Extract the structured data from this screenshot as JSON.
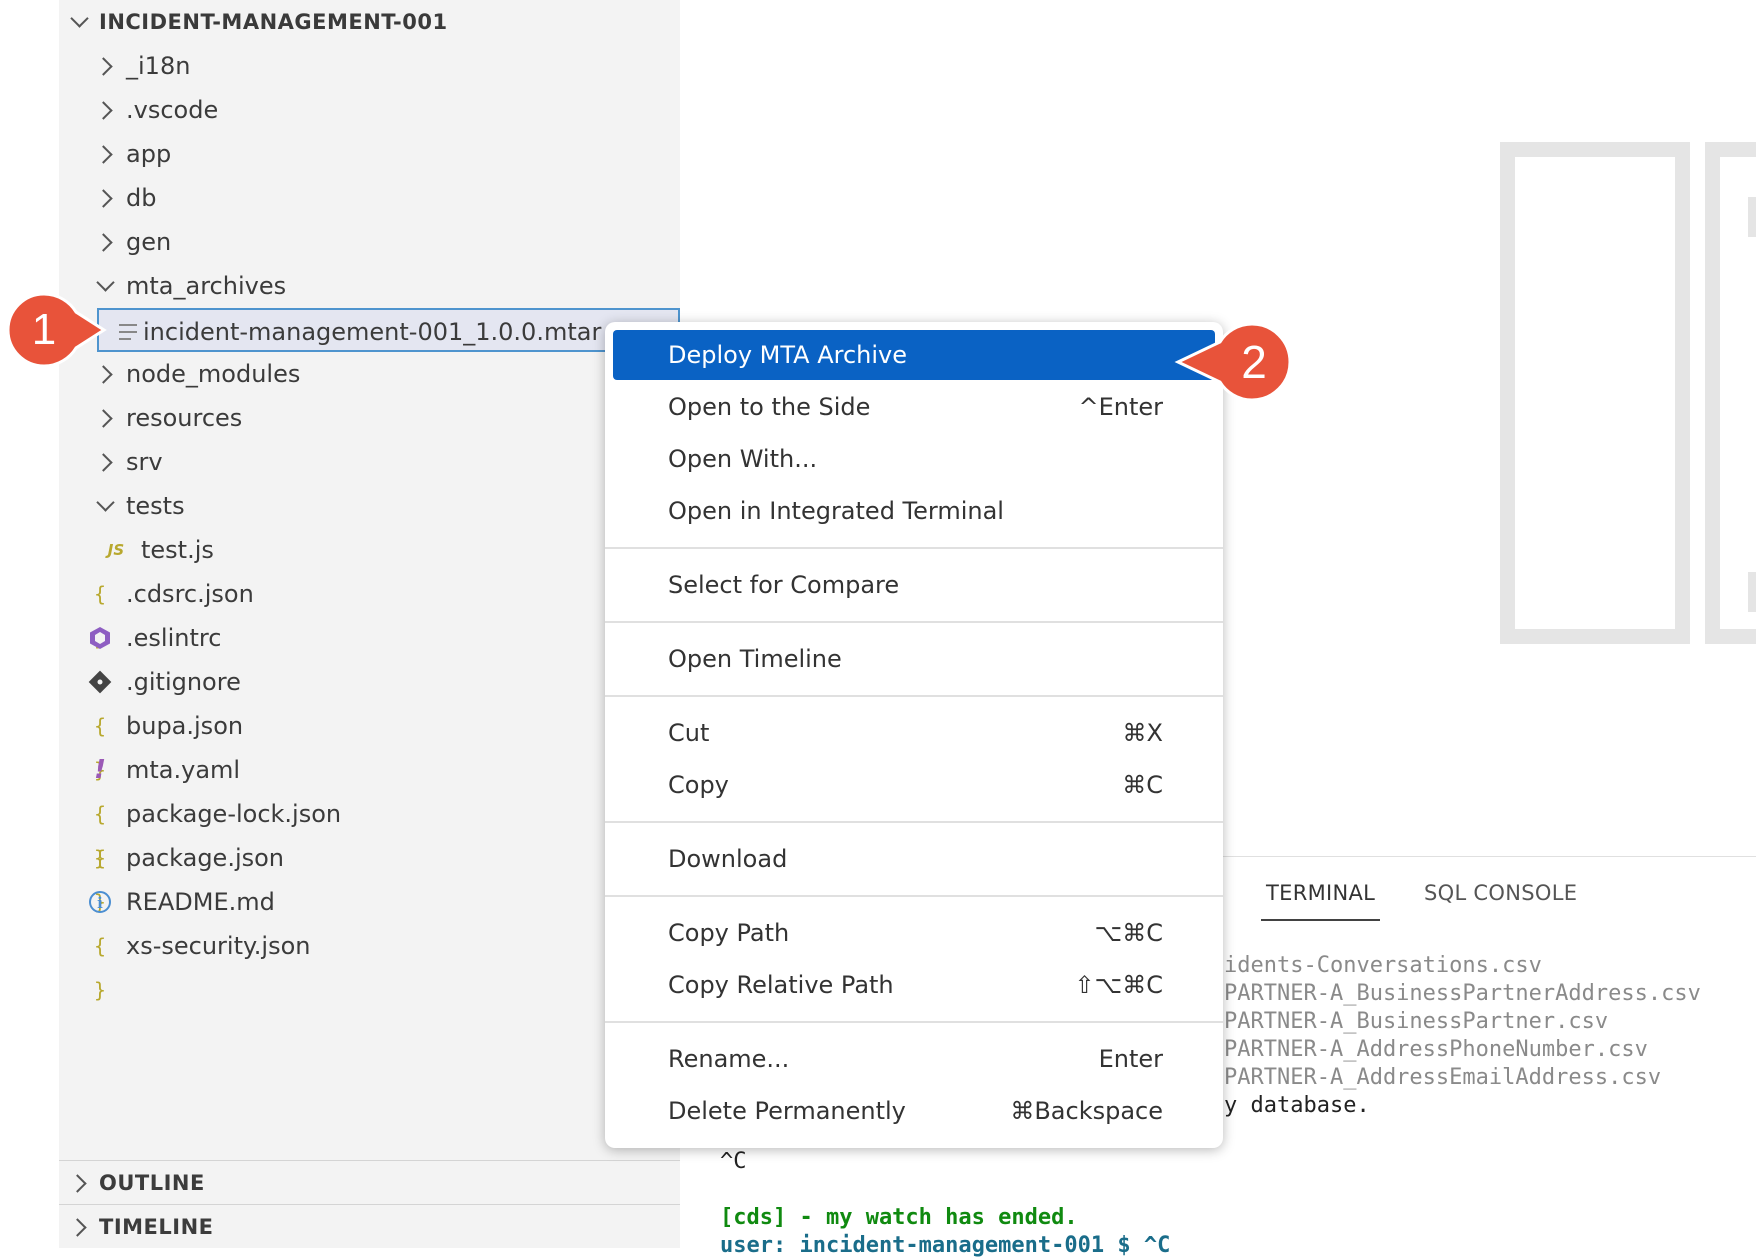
{
  "explorer": {
    "root": "INCIDENT-MANAGEMENT-001",
    "items": [
      {
        "label": "_i18n",
        "kind": "folder"
      },
      {
        "label": ".vscode",
        "kind": "folder"
      },
      {
        "label": "app",
        "kind": "folder"
      },
      {
        "label": "db",
        "kind": "folder"
      },
      {
        "label": "gen",
        "kind": "folder"
      },
      {
        "label": "mta_archives",
        "kind": "folder-open"
      },
      {
        "label": "incident-management-001_1.0.0.mtar",
        "kind": "file",
        "icon": "lines-icon"
      },
      {
        "label": "node_modules",
        "kind": "folder"
      },
      {
        "label": "resources",
        "kind": "folder"
      },
      {
        "label": "srv",
        "kind": "folder"
      },
      {
        "label": "tests",
        "kind": "folder-open"
      },
      {
        "label": "test.js",
        "kind": "file",
        "icon": "js-icon",
        "icon_text": "JS"
      },
      {
        "label": ".cdsrc.json",
        "kind": "file",
        "icon": "json-icon",
        "icon_text": "{ }"
      },
      {
        "label": ".eslintrc",
        "kind": "file",
        "icon": "eslint-icon"
      },
      {
        "label": ".gitignore",
        "kind": "file",
        "icon": "git-icon"
      },
      {
        "label": "bupa.json",
        "kind": "file",
        "icon": "json-icon",
        "icon_text": "{ }"
      },
      {
        "label": "mta.yaml",
        "kind": "file",
        "icon": "yaml-icon",
        "icon_text": "!"
      },
      {
        "label": "package-lock.json",
        "kind": "file",
        "icon": "json-icon",
        "icon_text": "{ }"
      },
      {
        "label": "package.json",
        "kind": "file",
        "icon": "json-icon",
        "icon_text": "{ }"
      },
      {
        "label": "README.md",
        "kind": "file",
        "icon": "info-icon",
        "icon_text": "i"
      },
      {
        "label": "xs-security.json",
        "kind": "file",
        "icon": "json-icon",
        "icon_text": "{ }"
      }
    ],
    "sections": [
      "OUTLINE",
      "TIMELINE"
    ]
  },
  "context_menu": {
    "groups": [
      [
        {
          "label": "Deploy MTA Archive",
          "key": "",
          "active": true
        },
        {
          "label": "Open to the Side",
          "key": "^Enter"
        },
        {
          "label": "Open With...",
          "key": ""
        },
        {
          "label": "Open in Integrated Terminal",
          "key": ""
        }
      ],
      [
        {
          "label": "Select for Compare",
          "key": ""
        }
      ],
      [
        {
          "label": "Open Timeline",
          "key": ""
        }
      ],
      [
        {
          "label": "Cut",
          "key": "⌘X"
        },
        {
          "label": "Copy",
          "key": "⌘C"
        }
      ],
      [
        {
          "label": "Download",
          "key": ""
        }
      ],
      [
        {
          "label": "Copy Path",
          "key": "⌥⌘C"
        },
        {
          "label": "Copy Relative Path",
          "key": "⇧⌥⌘C"
        }
      ],
      [
        {
          "label": "Rename...",
          "key": "Enter"
        },
        {
          "label": "Delete Permanently",
          "key": "⌘Backspace"
        }
      ]
    ]
  },
  "panel": {
    "tabs": [
      "TERMINAL",
      "SQL CONSOLE"
    ],
    "lines": [
      "idents-Conversations.csv",
      "PARTNER-A_BusinessPartnerAddress.csv",
      "PARTNER-A_BusinessPartner.csv",
      "PARTNER-A_AddressPhoneNumber.csv",
      "PARTNER-A_AddressEmailAddress.csv",
      "y database.",
      "^C",
      "[cds] - my watch has ended.",
      "user: incident-management-001 $ ^C"
    ]
  },
  "callouts": [
    "1",
    "2"
  ],
  "colors": {
    "accent": "#0a62c4",
    "callout": "#e8533a",
    "selection_border": "#4e94ce"
  }
}
